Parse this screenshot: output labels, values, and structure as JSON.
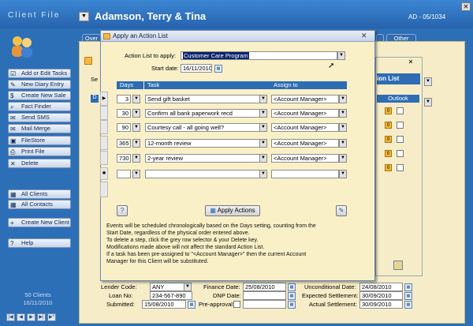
{
  "app": {
    "title_label": "Client File",
    "client_name": "Adamson, Terry & Tina",
    "ad_code": "AD - 05/1034"
  },
  "sidebar": {
    "items": [
      {
        "label": "Add or Edit Tasks",
        "icon": "tasks-icon"
      },
      {
        "label": "New Diary Entry",
        "icon": "diary-icon"
      },
      {
        "label": "Create New Sale",
        "icon": "sale-icon"
      },
      {
        "label": "Fact Finder",
        "icon": "search-icon"
      },
      {
        "label": "Send SMS",
        "icon": "sms-icon"
      },
      {
        "label": "Mail Merge",
        "icon": "mail-icon"
      },
      {
        "label": "FileStore",
        "icon": "folder-icon"
      },
      {
        "label": "Print File",
        "icon": "print-icon"
      },
      {
        "label": "Delete",
        "icon": "delete-icon"
      },
      {
        "label": "All Clients",
        "icon": "clients-icon"
      },
      {
        "label": "All Contacts",
        "icon": "contacts-icon"
      },
      {
        "label": "Create New Client",
        "icon": "new-client-icon"
      },
      {
        "label": "Help",
        "icon": "help-icon"
      }
    ],
    "client_count": "50 Clients",
    "date": "16/11/2010"
  },
  "tabs": {
    "overview": "Over",
    "other": "Other"
  },
  "background": {
    "outlook_label": "Outlook",
    "list_label": "ion List",
    "lender_code_label": "Lender Code:",
    "lender_code_value": "ANY",
    "loan_no_label": "Loan No:",
    "loan_no_value": "234-567-890",
    "submitted_label": "Submitted:",
    "submitted_value": "15/08/2010",
    "finance_date_label": "Finance Date:",
    "finance_date_value": "25/08/2010",
    "dnp_date_label": "DNP Date:",
    "dnp_date_value": "",
    "preapproval_label": "Pre-approval:",
    "unconditional_label": "Unconditional Date:",
    "unconditional_value": "24/08/2010",
    "expected_label": "Expected Settlement:",
    "expected_value": "30/09/2010",
    "actual_label": "Actual Settlement:",
    "actual_value": "30/09/2010"
  },
  "dialog": {
    "title": "Apply an Action List",
    "action_list_label": "Action List to apply:",
    "action_list_value": "Customer Care Program",
    "start_date_label": "Start date:",
    "start_date_value": "16/11/2010",
    "columns": {
      "days": "Days",
      "task": "Task",
      "assign": "Assign to"
    },
    "rows": [
      {
        "days": "3",
        "task": "Send gift basket",
        "assign": "<Account Manager>"
      },
      {
        "days": "30",
        "task": "Confirm all bank paperwork recd",
        "assign": "<Account Manager>"
      },
      {
        "days": "90",
        "task": "Courtesy call - all going well?",
        "assign": "<Account Manager>"
      },
      {
        "days": "365",
        "task": "12-month review",
        "assign": "<Account Manager>"
      },
      {
        "days": "730",
        "task": "2-year review",
        "assign": "<Account Manager>"
      }
    ],
    "apply_button": "Apply Actions",
    "notes": [
      "Events will be scheduled chronologically based on the Days setting, counting from the",
      "Start Date, regardless of the physical order entered above.",
      "To delete a step, click the grey row selector & your Delete key.",
      "Modifications made above will not affect the standard Action List.",
      "If a task has been pre-assigned to \"<Account Manager>\" then  the current Account",
      "Manager for this Client will be substituted."
    ]
  }
}
